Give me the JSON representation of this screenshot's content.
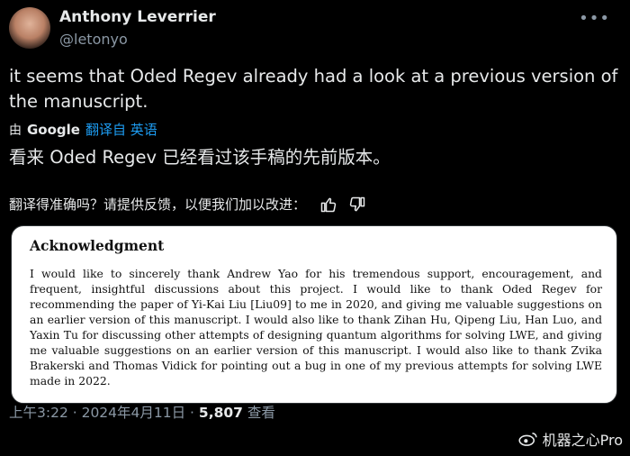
{
  "author": {
    "name": "Anthony Leverrier",
    "handle": "@letonyo"
  },
  "more_label": "•••",
  "tweet": {
    "text": "it seems that Oded Regev already had a look at a previous version of the manuscript."
  },
  "translation": {
    "by_icon": "由",
    "by_brand": "Google",
    "from_label": "翻译自 英语",
    "text": "看来 Oded Regev 已经看过该手稿的先前版本。",
    "rate_prompt": "翻译得准确吗？请提供反馈，以便我们加以改进："
  },
  "card": {
    "heading": "Acknowledgment",
    "body": "I would like to sincerely thank Andrew Yao for his tremendous support, encouragement, and frequent, insightful discussions about this project. I would like to thank Oded Regev for recommending the paper of Yi-Kai Liu [Liu09] to me in 2020, and giving me valuable suggestions on an earlier version of this manuscript. I would also like to thank Zihan Hu, Qipeng Liu, Han Luo, and Yaxin Tu for discussing other attempts of designing quantum algorithms for solving LWE, and giving me valuable suggestions on an earlier version of this manuscript. I would also like to thank Zvika Brakerski and Thomas Vidick for pointing out a bug in one of my previous attempts for solving LWE made in 2022."
  },
  "footer": {
    "timestamp": "上午3:22 · 2024年4月11日 ·",
    "views_count": "5,807",
    "views_label": "查看"
  },
  "watermark": {
    "text": "机器之心Pro"
  },
  "icons": {
    "thumbs_up": "thumbs-up-icon",
    "thumbs_down": "thumbs-down-icon",
    "more": "more-icon"
  },
  "colors": {
    "background": "#000000",
    "link": "#1d9bf0",
    "muted": "#8b98a5"
  }
}
